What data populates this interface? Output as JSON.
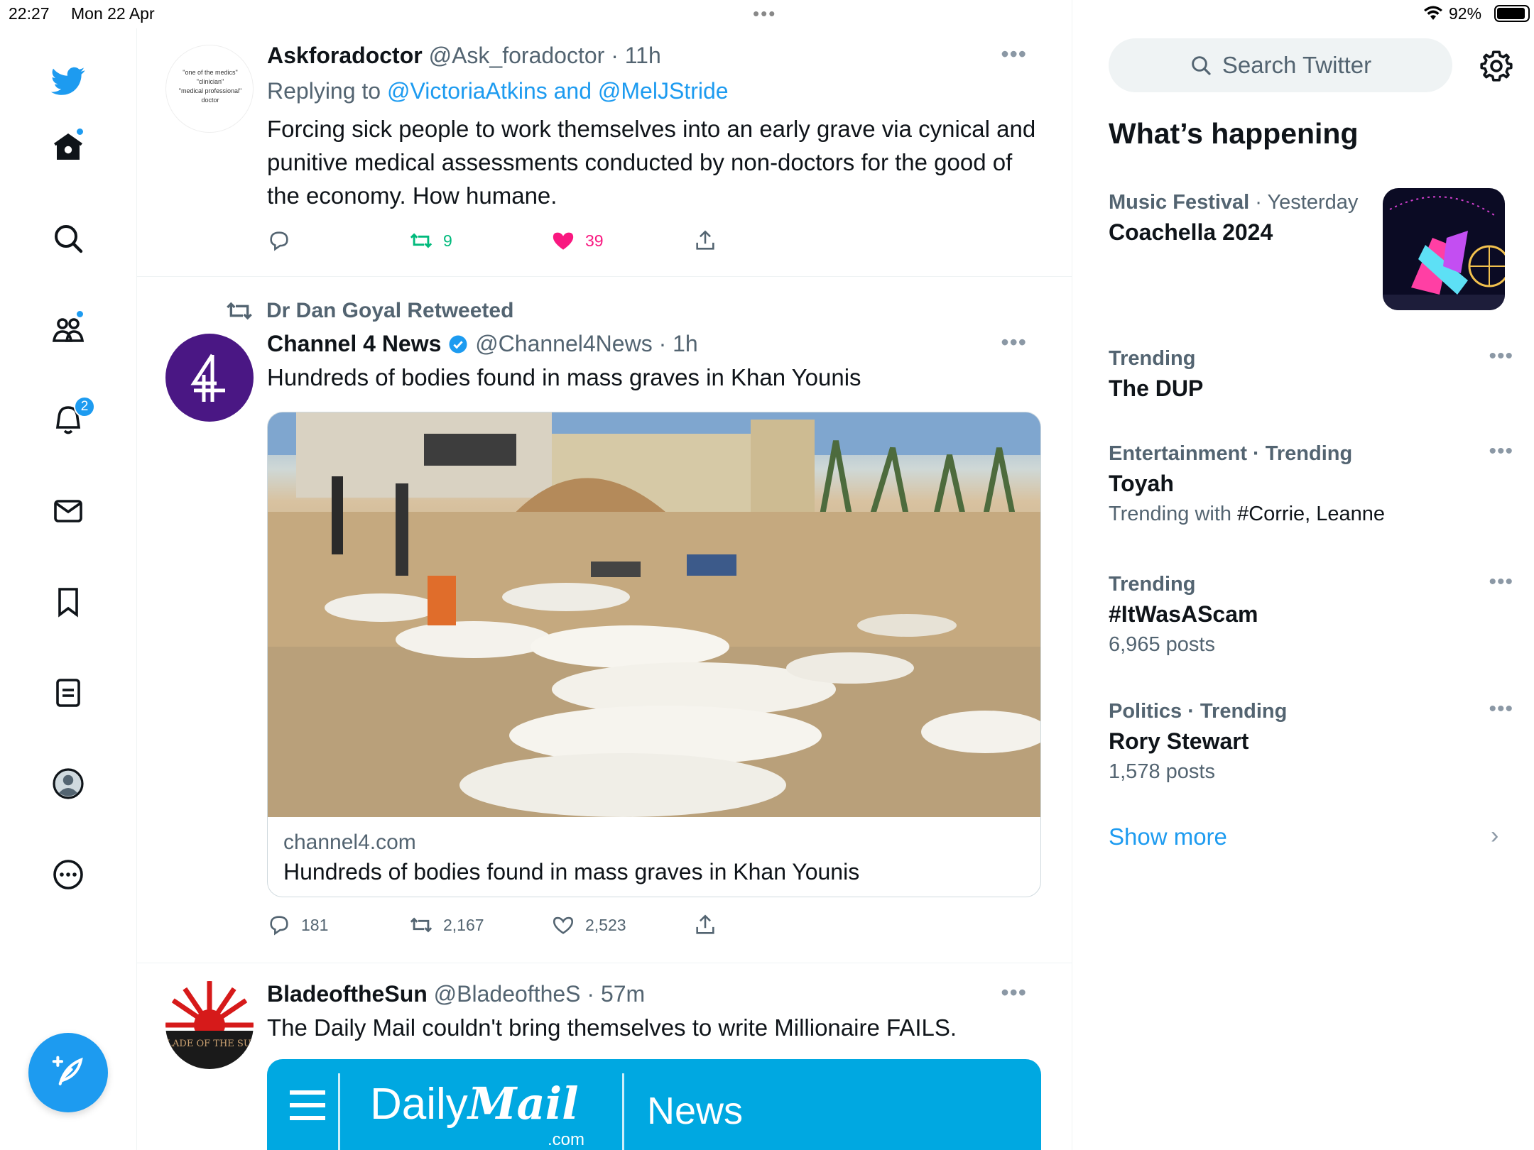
{
  "status_bar": {
    "time": "22:27",
    "date": "Mon 22 Apr",
    "battery_text": "92%",
    "battery_level": 0.92,
    "dots": "•••"
  },
  "sidebar": {
    "items": [
      {
        "name": "twitter-logo-icon"
      },
      {
        "name": "home-icon",
        "has_dot": true
      },
      {
        "name": "explore-icon"
      },
      {
        "name": "communities-icon",
        "has_dot": true
      },
      {
        "name": "notifications-icon",
        "badge": "2"
      },
      {
        "name": "messages-icon"
      },
      {
        "name": "bookmarks-icon"
      },
      {
        "name": "lists-icon"
      },
      {
        "name": "profile-icon"
      },
      {
        "name": "more-icon"
      }
    ],
    "compose_icon": "compose-icon"
  },
  "timeline": {
    "tweet1": {
      "name": "Askforadoctor",
      "handle": "@Ask_foradoctor",
      "sep": " · ",
      "time": "11h",
      "replying_prefix": "Replying to ",
      "replying_to": "@VictoriaAtkins and @MelJStride",
      "text": "Forcing sick people to work themselves into an early grave via cynical and punitive medical assessments conducted by non-doctors for the good of the economy. How humane.",
      "avatar_lines": [
        "\"one of the medics\"",
        "\"clinician\"",
        "\"medical professional\"",
        "doctor"
      ],
      "retweets": "9",
      "likes": "39",
      "more": "•••"
    },
    "tweet2": {
      "retweeted_by": "Dr Dan Goyal Retweeted",
      "name": "Channel 4 News",
      "handle": "@Channel4News",
      "sep": " · ",
      "time": "1h",
      "text": "Hundreds of bodies found in mass graves in Khan Younis",
      "card_domain": "channel4.com",
      "card_title": "Hundreds of bodies found in mass graves in Khan Younis",
      "replies": "181",
      "retweets": "2,167",
      "likes": "2,523",
      "more": "•••"
    },
    "tweet3": {
      "name": "BladeoftheSun",
      "handle": "@BladeoftheS",
      "sep": " · ",
      "time": "57m",
      "text": "The Daily Mail couldn't bring themselves to write Millionaire FAILS.",
      "avatar_text": "BLADE OF THE SUN",
      "banner_daily": "Daily",
      "banner_mail": "Mail",
      "banner_dotcom": ".com",
      "banner_news": "News",
      "more": "•••"
    }
  },
  "right": {
    "search_placeholder": "Search Twitter",
    "whats_happening": "What’s happening",
    "trends": [
      {
        "category": "Music Festival",
        "when": "Yesterday",
        "title": "Coachella 2024"
      },
      {
        "category": "Trending",
        "title": "The DUP"
      },
      {
        "category": "Entertainment · Trending",
        "title": "Toyah",
        "sub_prefix": "Trending with ",
        "sub_dark": "#Corrie, Leanne"
      },
      {
        "category": "Trending",
        "title": "#ItWasAScam",
        "posts": "6,965 posts"
      },
      {
        "category": "Politics · Trending",
        "title": "Rory Stewart",
        "posts": "1,578 posts"
      }
    ],
    "trend_sep": " · ",
    "trend_more": "•••",
    "show_more": "Show more",
    "show_more_chevron": "›"
  },
  "colors": {
    "accent": "#1d9bf0",
    "retweet_green": "#00ba7c",
    "like_pink": "#f91880",
    "channel4_purple": "#4a1784",
    "daily_mail_blue": "#00a8e1"
  }
}
